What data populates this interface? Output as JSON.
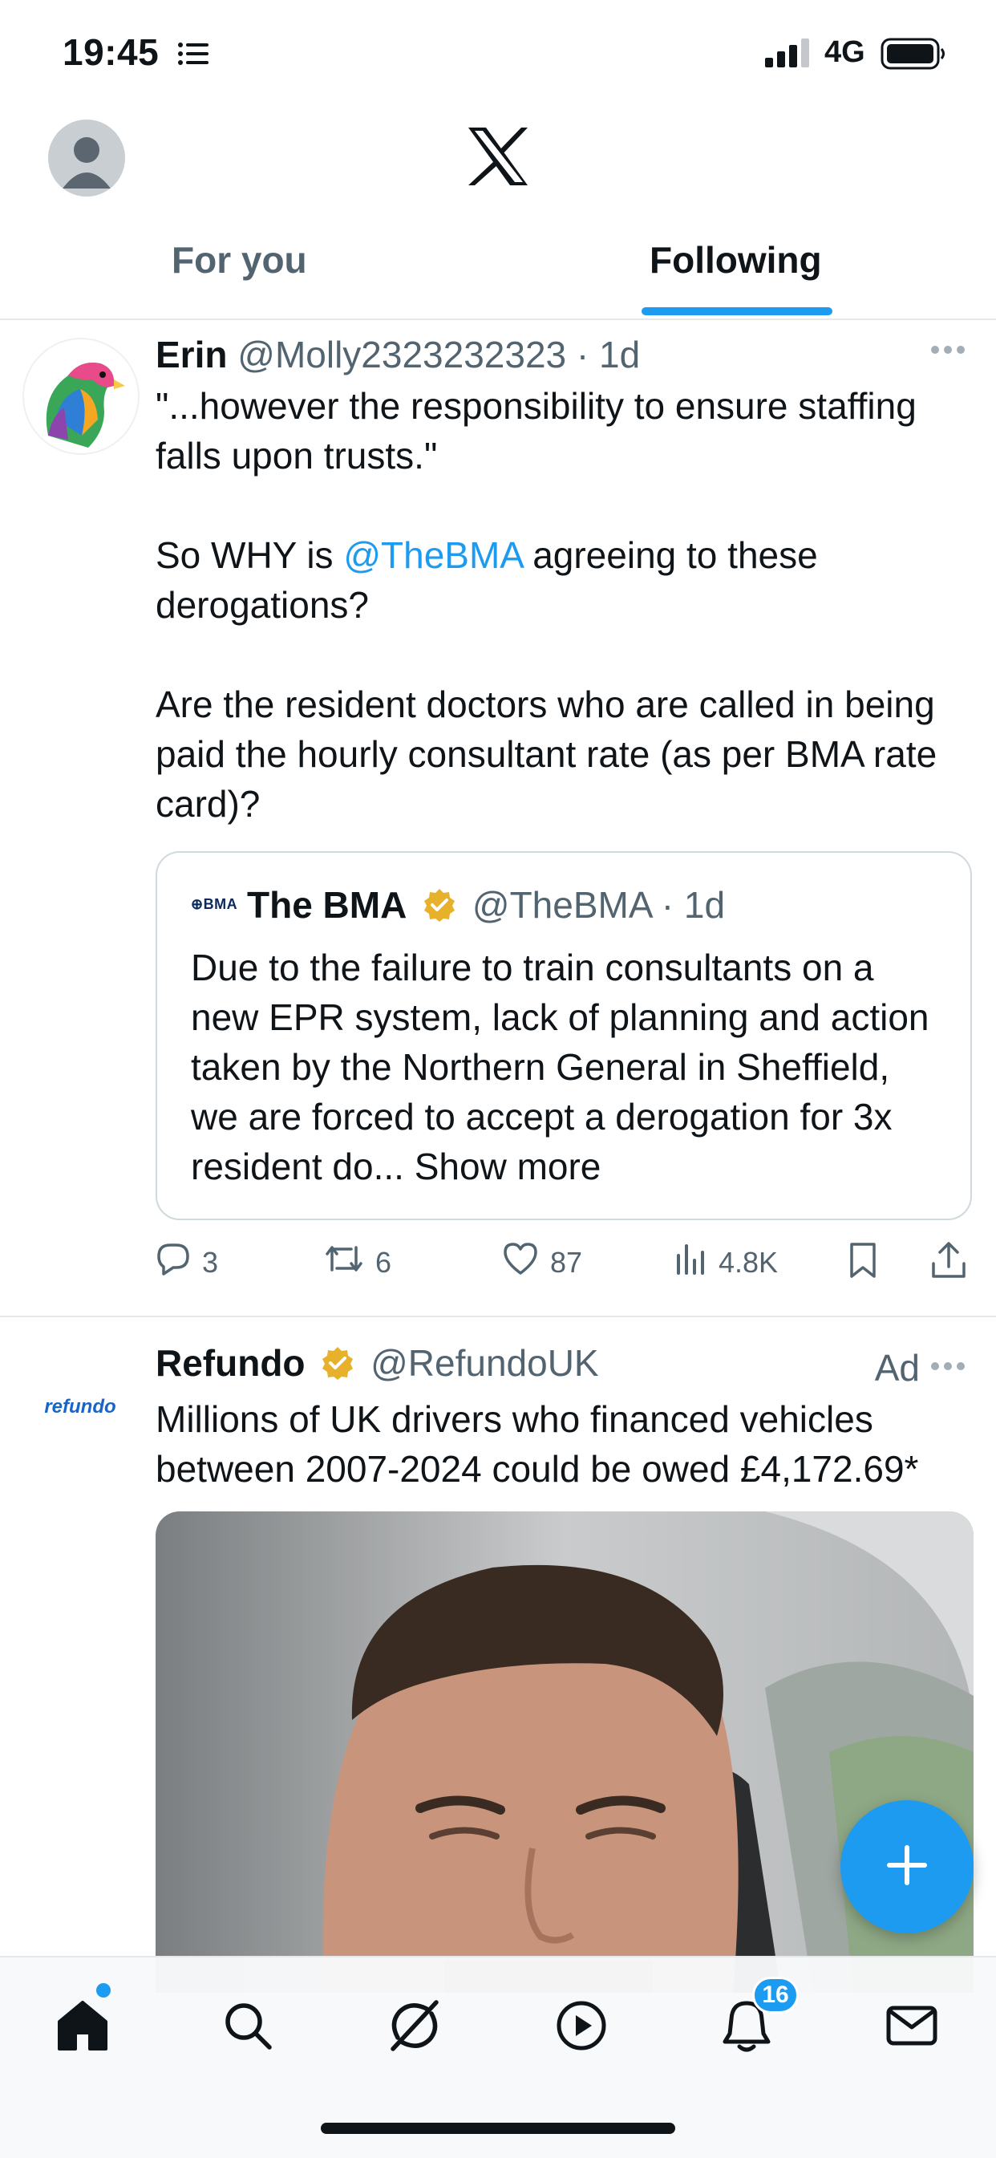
{
  "status_bar": {
    "time": "19:45",
    "network": "4G"
  },
  "tabs": [
    {
      "label": "For you",
      "active": false
    },
    {
      "label": "Following",
      "active": true
    }
  ],
  "tweet1": {
    "name": "Erin",
    "handle": "@Molly2323232323",
    "time": "· 1d",
    "paragraph1": "\"...however the responsibility to ensure staffing falls upon trusts.\"",
    "paragraph2_pre": "So WHY is ",
    "paragraph2_mention": "@TheBMA",
    "paragraph2_post": " agreeing to these derogations?",
    "paragraph3": "Are the resident doctors who are called in being paid the hourly consultant rate (as per BMA rate card)?",
    "quote": {
      "logo_text": "⊕BMA",
      "name": "The BMA",
      "handle": "@TheBMA",
      "time": "· 1d",
      "body": "Due to the failure to train consultants on a new EPR system, lack of planning and action taken by the Northern General in Sheffield, we are forced to accept a derogation for 3x resident do...",
      "show_more": "Show more"
    },
    "actions": {
      "replies": "3",
      "reposts": "6",
      "likes": "87",
      "views": "4.8K"
    }
  },
  "tweet2": {
    "name": "Refundo",
    "handle": "@RefundoUK",
    "ad_label": "Ad",
    "logo_text": "refundo",
    "body": "Millions of UK drivers who financed vehicles between 2007-2024 could be owed £4,172.69*"
  },
  "bottom_nav": {
    "notification_count": "16"
  },
  "colors": {
    "accent": "#1d9bf0",
    "text": "#0f1419",
    "secondary": "#536471",
    "gold": "#e8b12c"
  }
}
